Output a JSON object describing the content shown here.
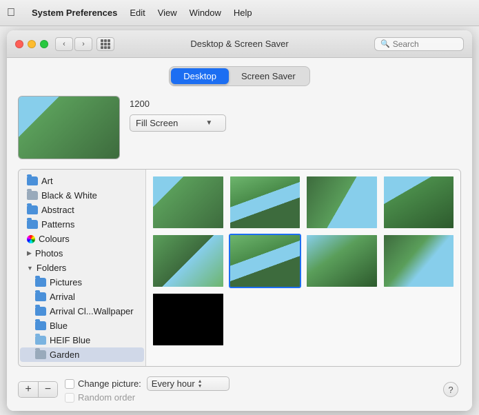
{
  "titlebar": {
    "apple": "&#63743;",
    "menu": [
      "Apple",
      "System Preferences",
      "Edit",
      "View",
      "Window",
      "Help"
    ]
  },
  "window": {
    "title": "Desktop & Screen Saver",
    "search_placeholder": "Search",
    "nav": {
      "back": "‹",
      "forward": "›"
    }
  },
  "tabs": {
    "desktop": "Desktop",
    "screen_saver": "Screen Saver"
  },
  "preview": {
    "number": "1200",
    "fill_screen": "Fill Screen"
  },
  "sidebar": {
    "items": [
      {
        "label": "Art",
        "type": "folder"
      },
      {
        "label": "Black & White",
        "type": "folder"
      },
      {
        "label": "Abstract",
        "type": "folder"
      },
      {
        "label": "Patterns",
        "type": "folder"
      },
      {
        "label": "Colours",
        "type": "colour"
      },
      {
        "label": "Photos",
        "type": "disclosure"
      },
      {
        "label": "Folders",
        "type": "disclosure-open"
      },
      {
        "label": "Pictures",
        "type": "folder-sub"
      },
      {
        "label": "Arrival",
        "type": "folder-sub"
      },
      {
        "label": "Arrival Cl...Wallpaper",
        "type": "folder-sub"
      },
      {
        "label": "Blue",
        "type": "folder-sub"
      },
      {
        "label": "HEIF Blue",
        "type": "folder-sub"
      },
      {
        "label": "Garden",
        "type": "folder-sub",
        "selected": true
      }
    ]
  },
  "photos": {
    "thumbs": [
      {
        "class": "garden1"
      },
      {
        "class": "garden2"
      },
      {
        "class": "garden3"
      },
      {
        "class": "garden4"
      },
      {
        "class": "garden5",
        "selected": true
      },
      {
        "class": "garden6"
      },
      {
        "class": "garden7"
      },
      {
        "class": "black-thumb"
      }
    ]
  },
  "bottom": {
    "add": "+",
    "remove": "−",
    "change_picture_label": "Change picture:",
    "interval": "Every hour",
    "random_label": "Random order",
    "help": "?"
  }
}
